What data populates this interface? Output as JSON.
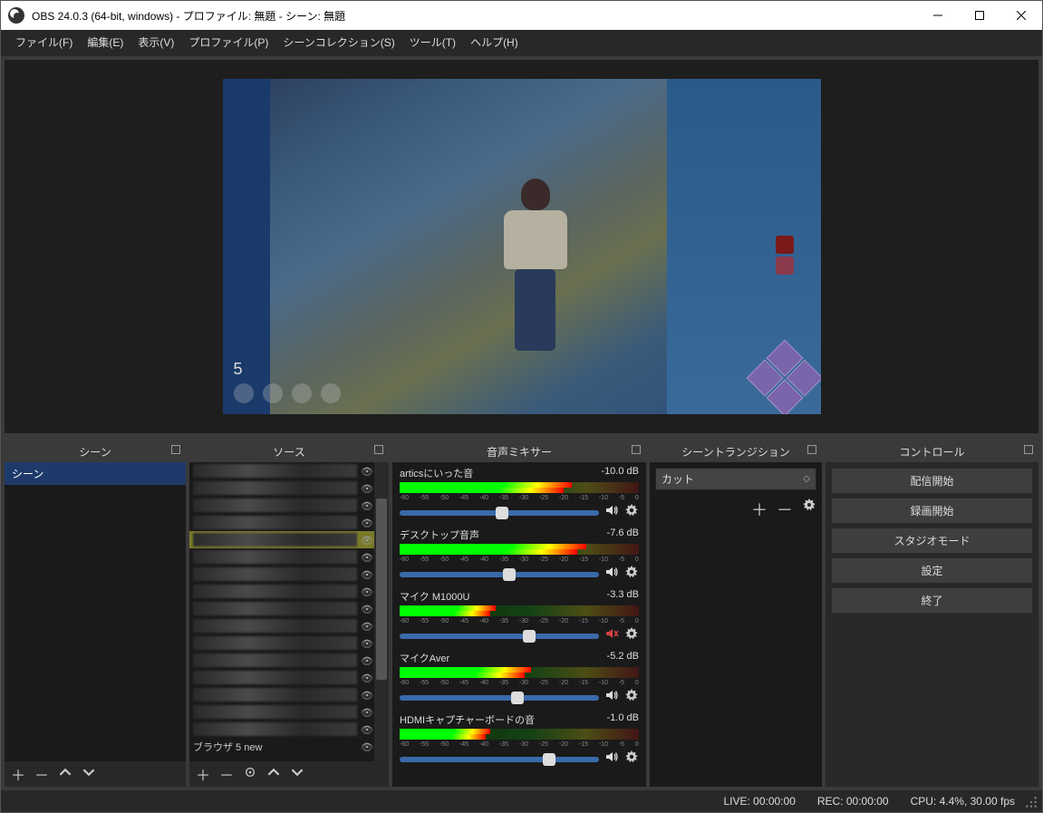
{
  "titlebar": "OBS 24.0.3 (64-bit, windows) - プロファイル: 無題 - シーン: 無題",
  "menu": {
    "file": "ファイル(F)",
    "edit": "編集(E)",
    "view": "表示(V)",
    "profile": "プロファイル(P)",
    "scenecol": "シーンコレクション(S)",
    "tools": "ツール(T)",
    "help": "ヘルプ(H)"
  },
  "hud": {
    "number": "5"
  },
  "panels": {
    "scenes": "シーン",
    "sources": "ソース",
    "mixer": "音声ミキサー",
    "transitions": "シーントランジション",
    "controls": "コントロール"
  },
  "scenes": {
    "item0": "シーン"
  },
  "sources": {
    "last": "ブラウザ 5 new"
  },
  "mixer": {
    "ticks": [
      "-60",
      "-55",
      "-50",
      "-45",
      "-40",
      "-35",
      "-30",
      "-25",
      "-20",
      "-15",
      "-10",
      "-5",
      "0"
    ],
    "ch": [
      {
        "name": "articsにいった音",
        "db": "-10.0 dB",
        "vol": 0.48,
        "level": 0.72,
        "muted": false
      },
      {
        "name": "デスクトップ音声",
        "db": "-7.6 dB",
        "vol": 0.52,
        "level": 0.78,
        "muted": false
      },
      {
        "name": "マイク M1000U",
        "db": "-3.3 dB",
        "vol": 0.62,
        "level": 0.4,
        "muted": true
      },
      {
        "name": "マイクAver",
        "db": "-5.2 dB",
        "vol": 0.56,
        "level": 0.55,
        "muted": false
      },
      {
        "name": "HDMIキャプチャーボードの音",
        "db": "-1.0 dB",
        "vol": 0.72,
        "level": 0.38,
        "muted": false
      }
    ]
  },
  "transitions": {
    "selected": "カット"
  },
  "controls": {
    "stream": "配信開始",
    "record": "録画開始",
    "studio": "スタジオモード",
    "settings": "設定",
    "exit": "終了"
  },
  "status": {
    "live": "LIVE: 00:00:00",
    "rec": "REC: 00:00:00",
    "cpu": "CPU: 4.4%, 30.00 fps"
  }
}
